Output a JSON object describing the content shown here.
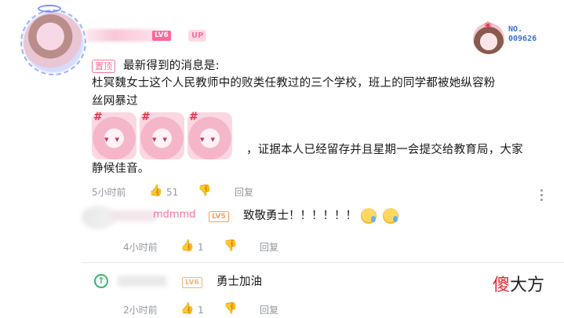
{
  "main_comment": {
    "level_badge": "LV6",
    "up_badge": "UP",
    "fan_number": "NO.\n009626",
    "pin_label": "置顶",
    "lines": [
      "最新得到的消息是:",
      "杜冥魏女士这个人民教师中的败类任教过的三个学校，班上的同学都被她纵容粉",
      "丝网暴过",
      "，证据本人已经留存并且星期一会提交给教育局，大家",
      "静候佳音。"
    ],
    "sticker_anger": "#",
    "time": "5小时前",
    "like_count": "51",
    "reply_label": "回复"
  },
  "replies": [
    {
      "username_visible": "mdmmd",
      "level_badge": "LV5",
      "text": "致敬勇士！！！！！！",
      "time": "4小时前",
      "like_count": "1",
      "reply_label": "回复"
    },
    {
      "level_badge": "LV6",
      "text": "勇士加油",
      "time": "2小时前",
      "like_count": "1",
      "reply_label": "回复"
    }
  ],
  "icons": {
    "like": "👍",
    "dislike": "👎",
    "up_arrow": "↑"
  },
  "watermark": {
    "highlight": "傻",
    "rest": "大方"
  },
  "colors": {
    "brand_pink": "#fb7299",
    "meta_gray": "#9499a0",
    "level_orange": "#ff9d5c"
  }
}
